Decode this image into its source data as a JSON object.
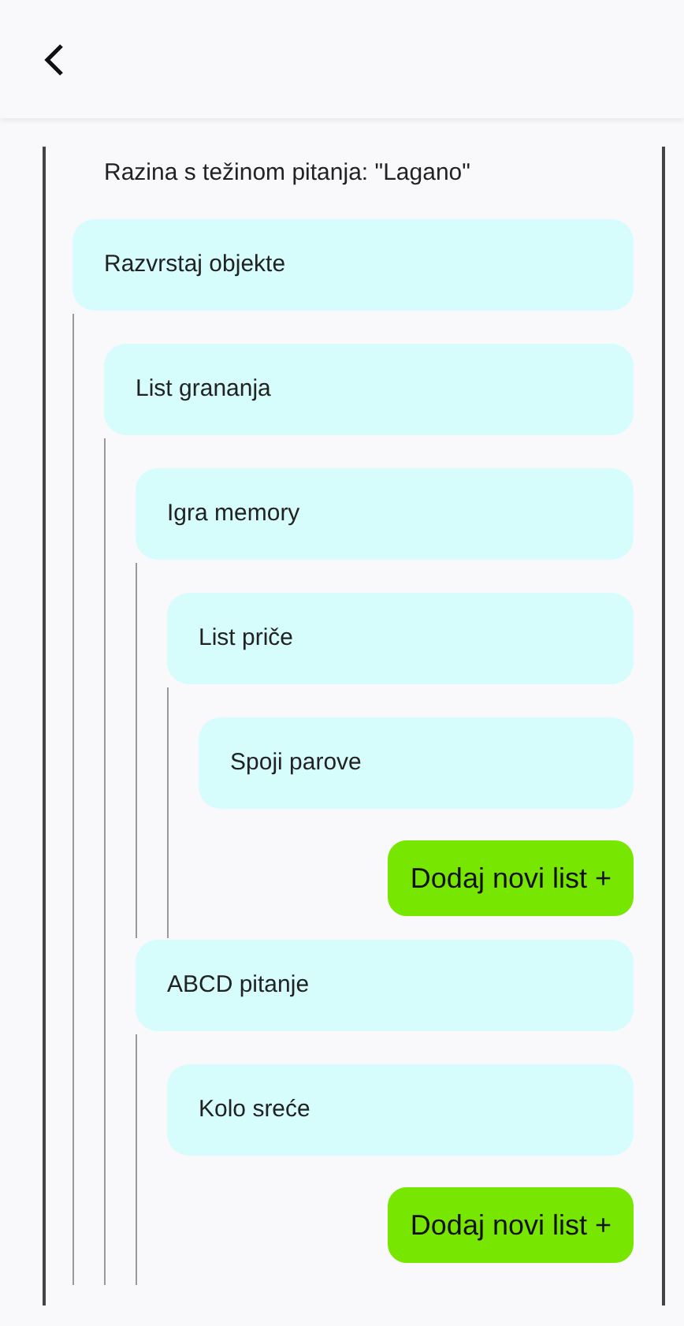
{
  "level_title": "Razina s težinom pitanja: \"Lagano\"",
  "tree": [
    {
      "kind": "node",
      "label": "Razvrstaj objekte",
      "children": [
        {
          "kind": "node",
          "label": "List grananja",
          "children": [
            {
              "kind": "node",
              "label": "Igra memory",
              "children": [
                {
                  "kind": "node",
                  "label": "List priče",
                  "children": [
                    {
                      "kind": "node",
                      "label": "Spoji parove"
                    },
                    {
                      "kind": "add_button",
                      "label": "Dodaj novi list +"
                    }
                  ]
                }
              ]
            },
            {
              "kind": "node",
              "label": "ABCD pitanje",
              "children": [
                {
                  "kind": "node",
                  "label": "Kolo sreće"
                },
                {
                  "kind": "add_button",
                  "label": "Dodaj novi list +"
                }
              ]
            }
          ]
        }
      ]
    }
  ]
}
